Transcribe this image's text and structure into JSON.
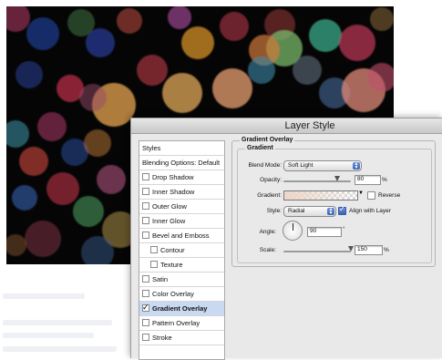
{
  "window": {
    "title": "Layer Style"
  },
  "styles_list": {
    "items": [
      {
        "label": "Styles",
        "checkbox": false,
        "checked": false,
        "indent": false,
        "selected": false
      },
      {
        "label": "Blending Options: Default",
        "checkbox": false,
        "checked": false,
        "indent": false,
        "selected": false
      },
      {
        "label": "Drop Shadow",
        "checkbox": true,
        "checked": false,
        "indent": false,
        "selected": false
      },
      {
        "label": "Inner Shadow",
        "checkbox": true,
        "checked": false,
        "indent": false,
        "selected": false
      },
      {
        "label": "Outer Glow",
        "checkbox": true,
        "checked": false,
        "indent": false,
        "selected": false
      },
      {
        "label": "Inner Glow",
        "checkbox": true,
        "checked": false,
        "indent": false,
        "selected": false
      },
      {
        "label": "Bevel and Emboss",
        "checkbox": true,
        "checked": false,
        "indent": false,
        "selected": false
      },
      {
        "label": "Contour",
        "checkbox": true,
        "checked": false,
        "indent": true,
        "selected": false
      },
      {
        "label": "Texture",
        "checkbox": true,
        "checked": false,
        "indent": true,
        "selected": false
      },
      {
        "label": "Satin",
        "checkbox": true,
        "checked": false,
        "indent": false,
        "selected": false
      },
      {
        "label": "Color Overlay",
        "checkbox": true,
        "checked": false,
        "indent": false,
        "selected": false
      },
      {
        "label": "Gradient Overlay",
        "checkbox": true,
        "checked": true,
        "indent": false,
        "selected": true
      },
      {
        "label": "Pattern Overlay",
        "checkbox": true,
        "checked": false,
        "indent": false,
        "selected": false
      },
      {
        "label": "Stroke",
        "checkbox": true,
        "checked": false,
        "indent": false,
        "selected": false
      }
    ]
  },
  "gradient_overlay": {
    "section_title": "Gradient Overlay",
    "group_title": "Gradient",
    "blend_mode_label": "Blend Mode:",
    "blend_mode_value": "Soft Light",
    "opacity_label": "Opacity:",
    "opacity_value": "80",
    "opacity_unit": "%",
    "opacity_level": 0.8,
    "gradient_label": "Gradient:",
    "reverse_label": "Reverse",
    "reverse_checked": false,
    "style_label": "Style:",
    "style_value": "Radial",
    "align_label": "Align with Layer",
    "align_checked": true,
    "angle_label": "Angle:",
    "angle_value": "90",
    "angle_unit": "°",
    "scale_label": "Scale:",
    "scale_value": "150",
    "scale_unit": "%",
    "scale_level": 1.0
  },
  "colors": {
    "selection": "#c9d9f2",
    "checkbox_accent": "#3c62b8",
    "photo_background": "#050505"
  }
}
